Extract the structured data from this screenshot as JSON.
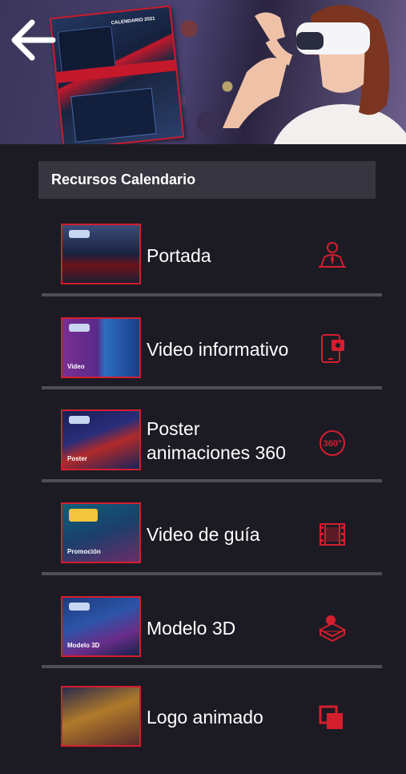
{
  "header": {
    "back_icon": "arrow-left-icon",
    "calendar_text": "CALENDARIO 2021"
  },
  "section": {
    "title": "Recursos Calendario"
  },
  "items": [
    {
      "label": "Portada",
      "icon": "presenter-icon",
      "thumb_caption": ""
    },
    {
      "label": "Video informativo",
      "icon": "phone-video-icon",
      "thumb_caption": "Video"
    },
    {
      "label_line1": "Poster",
      "label_line2": "animaciones 360",
      "icon": "360-icon",
      "thumb_caption": "Poster"
    },
    {
      "label": "Video de guía",
      "icon": "film-icon",
      "thumb_caption": "Promoción"
    },
    {
      "label": "Modelo 3D",
      "icon": "3d-model-icon",
      "thumb_caption": "Modelo 3D"
    },
    {
      "label": "Logo animado",
      "icon": "layers-icon",
      "thumb_caption": ""
    }
  ],
  "colors": {
    "accent": "#d41e2e",
    "background": "#1c1b24",
    "bar": "#373640"
  }
}
